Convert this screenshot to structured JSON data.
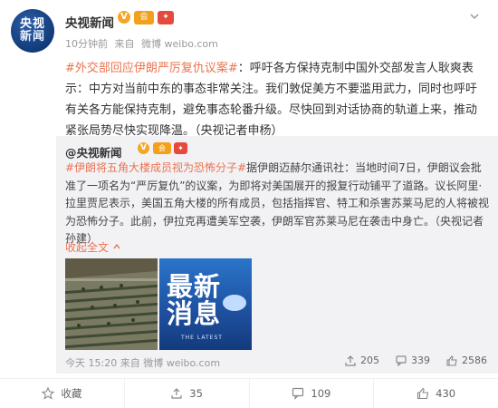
{
  "author": {
    "name": "央视新闻",
    "avatar_line1": "央视",
    "avatar_line2": "新闻"
  },
  "post": {
    "time": "10分钟前",
    "from": "来自",
    "source": "微博 weibo.com",
    "hashtag": "#外交部回应伊朗严厉复仇议案#",
    "headline": "：呼吁各方保持克制",
    "body": "中国外交部发言人耿爽表示：中方对当前中东的事态非常关注。我们敦促美方不要滥用武力，同时也呼吁有关各方能保持克制，避免事态轮番升级。尽快回到对话协商的轨道上来，推动紧张局势尽快实现降温。（央视记者申杨）"
  },
  "repost": {
    "author": "@央视新闻",
    "hashtag": "#伊朗将五角大楼成员视为恐怖分子#",
    "text": "据伊朗迈赫尔通讯社：当地时间7日，伊朗议会批准了一项名为“严厉复仇”的议案，为即将对美国展开的报复行动铺平了道路。议长阿里·拉里贾尼表示，美国五角大楼的所有成员，包括指挥官、特工和杀害苏莱马尼的人将被视为恐怖分子。此前，伊拉克再遭美军空袭，伊朗军官苏莱马尼在袭击中身亡。（央视记者孙建）",
    "expand": "收起全文",
    "time": "今天 15:20",
    "from": "来自",
    "source": "微博 weibo.com",
    "image2_text": "最新\n消息",
    "image2_small": "THE LATEST",
    "stats": {
      "reposts": "205",
      "comments": "339",
      "likes": "2586"
    }
  },
  "actions": {
    "favorite": "收藏",
    "repost": "35",
    "comment": "109",
    "like": "430"
  },
  "colors": {
    "accent": "#eb7350",
    "verified": "#f5a623",
    "repost_bg": "#f2f2f5"
  }
}
